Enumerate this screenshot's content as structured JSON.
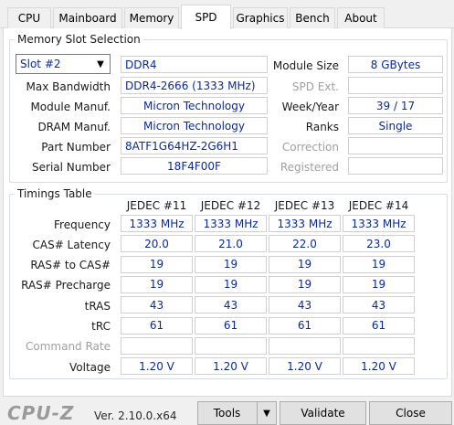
{
  "tabs": [
    {
      "label": "CPU"
    },
    {
      "label": "Mainboard"
    },
    {
      "label": "Memory"
    },
    {
      "label": "SPD",
      "active": true
    },
    {
      "label": "Graphics"
    },
    {
      "label": "Bench"
    },
    {
      "label": "About"
    }
  ],
  "slot_section": {
    "title": "Memory Slot Selection",
    "slot_selected": "Slot #2",
    "memory_type": "DDR4",
    "module_size_label": "Module Size",
    "module_size": "8 GBytes",
    "max_bandwidth_label": "Max Bandwidth",
    "max_bandwidth": "DDR4-2666 (1333 MHz)",
    "spd_ext_label": "SPD Ext.",
    "spd_ext": "",
    "module_manuf_label": "Module Manuf.",
    "module_manuf": "Micron Technology",
    "week_year_label": "Week/Year",
    "week_year": "39 / 17",
    "dram_manuf_label": "DRAM Manuf.",
    "dram_manuf": "Micron Technology",
    "ranks_label": "Ranks",
    "ranks": "Single",
    "part_number_label": "Part Number",
    "part_number": "8ATF1G64HZ-2G6H1",
    "correction_label": "Correction",
    "correction": "",
    "serial_number_label": "Serial Number",
    "serial_number": "18F4F00F",
    "registered_label": "Registered",
    "registered": ""
  },
  "timings": {
    "title": "Timings Table",
    "columns": [
      "JEDEC #11",
      "JEDEC #12",
      "JEDEC #13",
      "JEDEC #14"
    ],
    "rows": [
      {
        "label": "Frequency",
        "values": [
          "1333 MHz",
          "1333 MHz",
          "1333 MHz",
          "1333 MHz"
        ]
      },
      {
        "label": "CAS# Latency",
        "values": [
          "20.0",
          "21.0",
          "22.0",
          "23.0"
        ]
      },
      {
        "label": "RAS# to CAS#",
        "values": [
          "19",
          "19",
          "19",
          "19"
        ]
      },
      {
        "label": "RAS# Precharge",
        "values": [
          "19",
          "19",
          "19",
          "19"
        ]
      },
      {
        "label": "tRAS",
        "values": [
          "43",
          "43",
          "43",
          "43"
        ]
      },
      {
        "label": "tRC",
        "values": [
          "61",
          "61",
          "61",
          "61"
        ]
      },
      {
        "label": "Command Rate",
        "values": [
          "",
          "",
          "",
          ""
        ],
        "disabled": true
      },
      {
        "label": "Voltage",
        "values": [
          "1.20 V",
          "1.20 V",
          "1.20 V",
          "1.20 V"
        ]
      }
    ]
  },
  "footer": {
    "brand": "CPU-Z",
    "version": "Ver. 2.10.0.x64",
    "tools_label": "Tools",
    "validate_label": "Validate",
    "close_label": "Close"
  }
}
